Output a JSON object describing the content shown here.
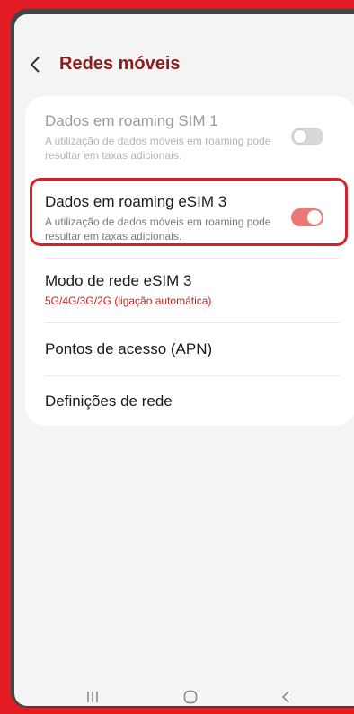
{
  "header": {
    "title": "Redes móveis"
  },
  "settings": {
    "roaming_sim1": {
      "title": "Dados em roaming SIM 1",
      "subtitle": "A utilização de dados móveis em roaming pode resultar em taxas adicionais.",
      "enabled": false,
      "disabled_style": true
    },
    "roaming_esim3": {
      "title": "Dados em roaming eSIM 3",
      "subtitle": "A utilização de dados móveis em roaming pode resultar em taxas adicionais.",
      "enabled": true
    },
    "network_mode": {
      "title": "Modo de rede eSIM 3",
      "value": "5G/4G/3G/2G (ligação automática)"
    },
    "apn": {
      "title": "Pontos de acesso (APN)"
    },
    "network_settings": {
      "title": "Definições de rede"
    }
  },
  "colors": {
    "background": "#e31b23",
    "accent": "#8e1c1c",
    "toggle_on": "#ec7876",
    "highlight": "#d6202a",
    "value_text": "#c81e1e"
  },
  "navbar": {
    "icons": [
      "recent-apps-icon",
      "home-icon",
      "back-icon"
    ]
  }
}
